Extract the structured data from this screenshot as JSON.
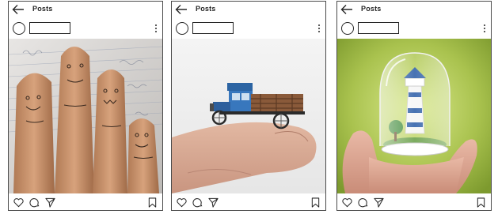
{
  "posts": [
    {
      "header_title": "Posts",
      "photo_subject": "fingers-with-drawn-faces",
      "icons": {
        "back": "arrow-left-icon",
        "more": "more-vertical-icon",
        "like": "heart-icon",
        "comment": "comment-icon",
        "share": "send-icon",
        "save": "bookmark-icon"
      }
    },
    {
      "header_title": "Posts",
      "photo_subject": "miniature-truck-on-finger",
      "icons": {
        "back": "arrow-left-icon",
        "more": "more-vertical-icon",
        "like": "heart-icon",
        "comment": "comment-icon",
        "share": "send-icon",
        "save": "bookmark-icon"
      }
    },
    {
      "header_title": "Posts",
      "photo_subject": "lighthouse-in-glass-dome",
      "icons": {
        "back": "arrow-left-icon",
        "more": "more-vertical-icon",
        "like": "heart-icon",
        "comment": "comment-icon",
        "share": "send-icon",
        "save": "bookmark-icon"
      }
    }
  ],
  "colors": {
    "border": "#4a4a4a",
    "text": "#262626",
    "background": "#ffffff"
  }
}
